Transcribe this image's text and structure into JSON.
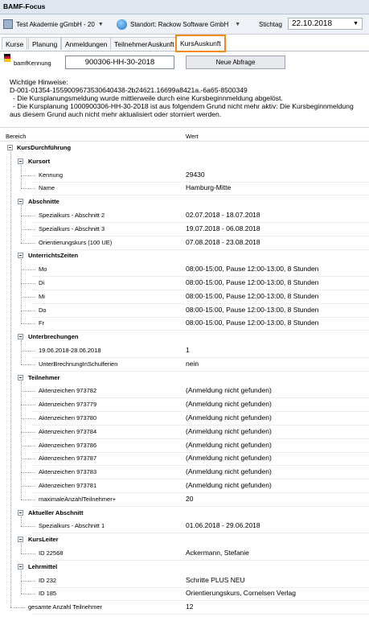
{
  "window": {
    "title": "BAMF-Focus"
  },
  "toolbar": {
    "org": "Test Akademie gGmbH - 20",
    "site": "Standort: Rackow Software GmbH",
    "stichtag_label": "Stichtag",
    "stichtag_value": "22.10.2018"
  },
  "tabs": [
    "Kurse",
    "Planung",
    "Anmeldungen",
    "TeilnehmerAuskunft",
    "KursAuskunft"
  ],
  "query": {
    "label": "bamfKennung",
    "value": "900306-HH-30-2018",
    "button": "Neue Abfrage"
  },
  "hints": {
    "title": "Wichtige Hinweise:",
    "lines": [
      "D-001-01354-1559009673530640438-2b24621.16699a8421a.-6a65-8500349",
      "- Die Kursplanungsmeldung wurde mittlerweile durch eine Kursbeginnmeldung abgelöst.",
      "- Die Kursplanung 1000900306-HH-30-2018 ist aus folgendem Grund nicht mehr aktiv: Die Kursbeginnmeldung",
      "aus diesem Grund auch nicht mehr aktualisiert oder storniert werden."
    ]
  },
  "grid": {
    "col_bereich": "Bereich",
    "col_wert": "Wert",
    "rows": [
      {
        "level": 0,
        "label": "KursDurchführung",
        "value": "",
        "group": true
      },
      {
        "level": 1,
        "label": "Kursort",
        "value": "",
        "group": true
      },
      {
        "level": 2,
        "label": "Kennung",
        "value": "29430"
      },
      {
        "level": 2,
        "label": "Name",
        "value": "Hamburg-Mitte"
      },
      {
        "level": 1,
        "label": "Abschnitte",
        "value": "",
        "group": true
      },
      {
        "level": 2,
        "label": "Spezialkurs - Abschnitt 2",
        "value": "02.07.2018 - 18.07.2018"
      },
      {
        "level": 2,
        "label": "Spezialkurs - Abschnitt 3",
        "value": "19.07.2018 - 06.08.2018"
      },
      {
        "level": 2,
        "label": "Orientierungskurs (100 UE)",
        "value": "07.08.2018 - 23.08.2018"
      },
      {
        "level": 1,
        "label": "UnterrichtsZeiten",
        "value": "",
        "group": true
      },
      {
        "level": 2,
        "label": "Mo",
        "value": "08:00-15:00,  Pause 12:00-13:00, 8 Stunden"
      },
      {
        "level": 2,
        "label": "Di",
        "value": "08:00-15:00,  Pause 12:00-13:00, 8 Stunden"
      },
      {
        "level": 2,
        "label": "Mi",
        "value": "08:00-15:00,  Pause 12:00-13:00, 8 Stunden"
      },
      {
        "level": 2,
        "label": "Do",
        "value": "08:00-15:00,  Pause 12:00-13:00, 8 Stunden"
      },
      {
        "level": 2,
        "label": "Fr",
        "value": "08:00-15:00,  Pause 12:00-13:00, 8 Stunden"
      },
      {
        "level": 1,
        "label": "Unterbrechungen",
        "value": "",
        "group": true
      },
      {
        "level": 2,
        "label": "19.06.2018-28.06.2018",
        "value": "1"
      },
      {
        "level": 2,
        "label": "UnterBrechnungInSchulferien",
        "value": "nein"
      },
      {
        "level": 1,
        "label": "Teilnehmer",
        "value": "",
        "group": true
      },
      {
        "level": 2,
        "label": "Aktenzeichen 973782",
        "value": "(Anmeldung nicht gefunden)"
      },
      {
        "level": 2,
        "label": "Aktenzeichen 973779",
        "value": "(Anmeldung nicht gefunden)"
      },
      {
        "level": 2,
        "label": "Aktenzeichen 973780",
        "value": "(Anmeldung nicht gefunden)"
      },
      {
        "level": 2,
        "label": "Aktenzeichen 973784",
        "value": "(Anmeldung nicht gefunden)"
      },
      {
        "level": 2,
        "label": "Aktenzeichen 973786",
        "value": "(Anmeldung nicht gefunden)"
      },
      {
        "level": 2,
        "label": "Aktenzeichen 973787",
        "value": "(Anmeldung nicht gefunden)"
      },
      {
        "level": 2,
        "label": "Aktenzeichen 973783",
        "value": "(Anmeldung nicht gefunden)"
      },
      {
        "level": 2,
        "label": "Aktenzeichen 973781",
        "value": "(Anmeldung nicht gefunden)"
      },
      {
        "level": 2,
        "label": "maximaleAnzahlTeilnehmer+",
        "value": "20"
      },
      {
        "level": 1,
        "label": "Aktueller Abschnitt",
        "value": "",
        "group": true
      },
      {
        "level": 2,
        "label": "Spezialkurs - Abschnitt 1",
        "value": "01.06.2018 - 29.06.2018"
      },
      {
        "level": 1,
        "label": "KursLeiter",
        "value": "",
        "group": true
      },
      {
        "level": 2,
        "label": "ID 22568",
        "value": "Ackermann, Stefanie"
      },
      {
        "level": 1,
        "label": "Lehrmittel",
        "value": "",
        "group": true
      },
      {
        "level": 2,
        "label": "ID 232",
        "value": "Schritte PLUS NEU"
      },
      {
        "level": 2,
        "label": "ID 185",
        "value": "Orientierungskurs, Cornelsen Verlag"
      },
      {
        "level": 1,
        "label": "gesamte Anzahl Teilnehmer",
        "value": "12",
        "leaf": true
      }
    ]
  }
}
